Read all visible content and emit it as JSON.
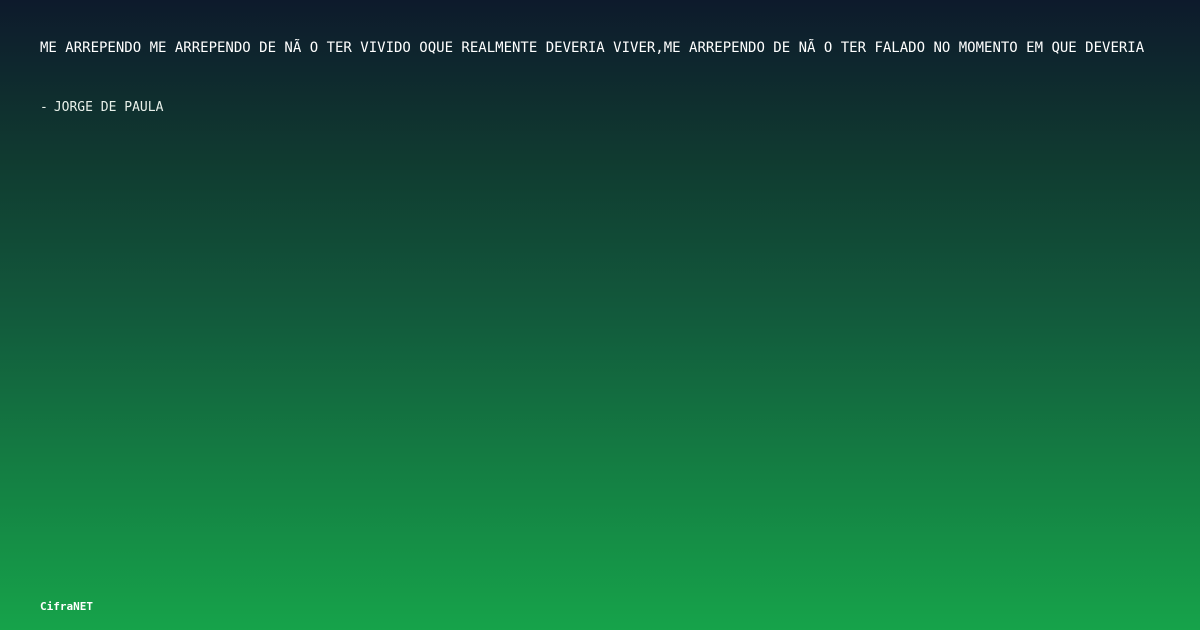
{
  "quote": {
    "text": "ME ARREPENDO ME ARREPENDO DE NÃ O TER VIVIDO OQUE REALMENTE DEVERIA VIVER,ME ARREPENDO DE NÃ O TER FALADO NO MOMENTO EM QUE DEVERIA"
  },
  "author": {
    "dash": "-",
    "name": "JORGE DE PAULA"
  },
  "brand": {
    "name": "CifraNET"
  }
}
